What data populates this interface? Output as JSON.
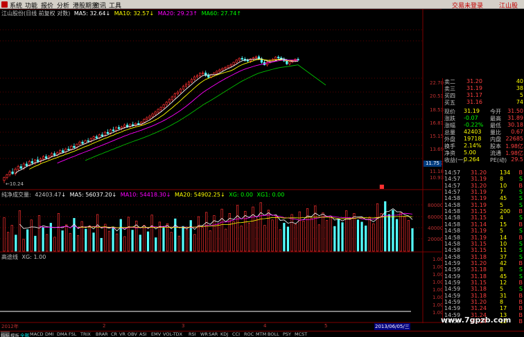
{
  "menu": {
    "items": [
      "系统",
      "功能",
      "报价",
      "分析",
      "港股期货",
      "资讯",
      "工具"
    ],
    "login": "交易未登录",
    "right": "江山股"
  },
  "main_caption": {
    "name": "江山股份(日线 前复权 对数)",
    "ma5": "MA5: 32.64",
    "ma10": "MA10: 32.57",
    "ma20": "MA20: 29.23",
    "ma60": "MA60: 27.74"
  },
  "vol_caption": {
    "name": "纯净成交量:",
    "val": "42403.47",
    "ma5": "MA5: 56037.20",
    "ma10": "MA10: 54418.30",
    "ma20": "MA20: 54902.25",
    "xg0": "XG: 0.00",
    "xg1": "XG1: 0.00"
  },
  "third_caption": {
    "name": "高途线",
    "xg": "XG: 1.00"
  },
  "y_main": [
    "22.70",
    "20.51",
    "18.53",
    "16.81",
    "15.15",
    "13.69",
    "12.37",
    "11.18",
    "10.93"
  ],
  "y_vol": [
    "80000",
    "60000",
    "40000",
    "20000"
  ],
  "y_third": [
    "1.00",
    "1.00",
    "1.00",
    "1.00",
    "1.00",
    "1.00",
    "1.00",
    "1.00"
  ],
  "low_label": "10.24",
  "hilite": "11.75",
  "x_axis": [
    "2012年",
    "2",
    "3",
    "4",
    "5",
    "2013/06/05/三"
  ],
  "quote": [
    {
      "l": "卖二",
      "v": "31.20",
      "n": "40"
    },
    {
      "l": "卖三",
      "v": "31.19",
      "n": "38"
    },
    {
      "l": "买四",
      "v": "31.17",
      "n": "5"
    },
    {
      "l": "买五",
      "v": "31.16",
      "n": "74"
    }
  ],
  "stats": [
    {
      "a": "现价",
      "b": "31.19",
      "c": "今开",
      "d": "31.50"
    },
    {
      "a": "涨跌",
      "b": "-0.07",
      "c": "最高",
      "d": "31.89"
    },
    {
      "a": "涨幅",
      "b": "-0.22%",
      "c": "最低",
      "d": "30.18"
    },
    {
      "a": "总量",
      "b": "42403",
      "c": "量比",
      "d": "0.67"
    },
    {
      "a": "外盘",
      "b": "19718",
      "c": "内盘",
      "d": "22685"
    },
    {
      "a": "换手",
      "b": "2.14%",
      "c": "股本",
      "d": "1.98亿"
    },
    {
      "a": "净资",
      "b": "5.00",
      "c": "流通",
      "d": "1.98亿"
    },
    {
      "a": "收益(一)",
      "b": "0.264",
      "c": "PE(动)",
      "d": "29.5"
    }
  ],
  "ticks": [
    {
      "t": "14:57",
      "p": "31.20",
      "v": "134",
      "s": "B"
    },
    {
      "t": "14:57",
      "p": "31.19",
      "v": "8",
      "s": "S"
    },
    {
      "t": "14:57",
      "p": "31.20",
      "v": "10",
      "s": "B"
    },
    {
      "t": "14:57",
      "p": "31.19",
      "v": "7",
      "s": "S"
    },
    {
      "t": "14:58",
      "p": "31.19",
      "v": "45",
      "s": "S"
    },
    {
      "t": "14:58",
      "p": "31.19",
      "v": "5",
      "s": "S"
    },
    {
      "t": "14:58",
      "p": "31.15",
      "v": "200",
      "s": "B"
    },
    {
      "t": "14:58",
      "p": "31.15",
      "v": "4",
      "s": "S"
    },
    {
      "t": "14:58",
      "p": "31.14",
      "v": "15",
      "s": "B"
    },
    {
      "t": "14:58",
      "p": "31.19",
      "v": "5",
      "s": "S"
    },
    {
      "t": "14:58",
      "p": "31.19",
      "v": "14",
      "s": "B"
    },
    {
      "t": "14:58",
      "p": "31.15",
      "v": "10",
      "s": "S"
    },
    {
      "t": "14:58",
      "p": "31.15",
      "v": "11",
      "s": "S"
    },
    {
      "t": "14:58",
      "p": "31.18",
      "v": "37",
      "s": "S"
    },
    {
      "t": "14:59",
      "p": "31.20",
      "v": "42",
      "s": "B"
    },
    {
      "t": "14:59",
      "p": "31.18",
      "v": "8",
      "s": "S"
    },
    {
      "t": "14:59",
      "p": "31.18",
      "v": "45",
      "s": "S"
    },
    {
      "t": "14:59",
      "p": "31.15",
      "v": "12",
      "s": "B"
    },
    {
      "t": "14:59",
      "p": "31.18",
      "v": "5",
      "s": "S"
    },
    {
      "t": "14:59",
      "p": "31.18",
      "v": "31",
      "s": "B"
    },
    {
      "t": "14:59",
      "p": "31.20",
      "v": "8",
      "s": "B"
    },
    {
      "t": "14:59",
      "p": "31.24",
      "v": "17",
      "s": "B"
    },
    {
      "t": "14:59",
      "p": "31.24",
      "v": "13",
      "s": "B"
    },
    {
      "t": "14:59",
      "p": "31.24",
      "v": "12",
      "s": "B"
    }
  ],
  "tabs": [
    "指标",
    "模板",
    "全部",
    "MACD",
    "DMI",
    "DMA",
    "FSL",
    "TRIX",
    "BRAR",
    "CR",
    "VR",
    "OBV",
    "ASI",
    "EMV",
    "VOL-TDX",
    "RSI",
    "WR",
    "SAR",
    "KDJ",
    "CCI",
    "ROC",
    "MTM",
    "BOLL",
    "PSY",
    "MCST"
  ],
  "watermark": "www.7gpzb.com",
  "candles": {
    "ohlc": [
      [
        10.5,
        10.9,
        10.24,
        10.8
      ],
      [
        10.8,
        11.2,
        10.6,
        11.1
      ],
      [
        11.1,
        11.6,
        10.9,
        11.4
      ],
      [
        11.4,
        11.8,
        11.1,
        11.2
      ],
      [
        11.2,
        11.9,
        11.0,
        11.7
      ],
      [
        11.7,
        12.2,
        11.5,
        12.0
      ],
      [
        12.0,
        12.3,
        11.7,
        11.8
      ],
      [
        11.8,
        12.5,
        11.6,
        12.3
      ],
      [
        12.3,
        12.6,
        12.0,
        12.1
      ],
      [
        12.1,
        12.8,
        12.0,
        12.6
      ],
      [
        12.6,
        13.0,
        12.3,
        12.4
      ],
      [
        12.4,
        12.9,
        12.2,
        12.8
      ],
      [
        12.8,
        13.2,
        12.5,
        12.6
      ],
      [
        12.6,
        13.1,
        12.4,
        12.9
      ],
      [
        12.9,
        13.4,
        12.7,
        13.2
      ],
      [
        13.2,
        13.5,
        12.9,
        13.0
      ],
      [
        13.0,
        13.4,
        12.8,
        13.3
      ],
      [
        13.3,
        13.8,
        13.1,
        13.6
      ],
      [
        13.6,
        13.9,
        13.2,
        13.4
      ],
      [
        13.4,
        13.9,
        13.2,
        13.7
      ],
      [
        13.7,
        14.2,
        13.5,
        14.0
      ],
      [
        14.0,
        14.3,
        13.6,
        13.8
      ],
      [
        13.8,
        14.4,
        13.6,
        14.2
      ],
      [
        14.2,
        14.6,
        13.9,
        14.1
      ],
      [
        14.1,
        14.8,
        14.0,
        14.6
      ],
      [
        14.6,
        15.0,
        14.3,
        14.4
      ],
      [
        14.4,
        15.0,
        14.2,
        14.9
      ],
      [
        14.9,
        15.4,
        14.7,
        15.2
      ],
      [
        15.2,
        15.5,
        14.8,
        15.0
      ],
      [
        15.0,
        15.6,
        14.9,
        15.4
      ],
      [
        15.4,
        15.8,
        15.1,
        15.3
      ],
      [
        15.3,
        15.9,
        15.1,
        15.7
      ],
      [
        15.7,
        16.2,
        15.5,
        16.0
      ],
      [
        16.0,
        16.3,
        15.6,
        15.8
      ],
      [
        15.8,
        16.5,
        15.6,
        16.3
      ],
      [
        16.3,
        16.7,
        16.0,
        16.1
      ],
      [
        16.1,
        16.9,
        16.0,
        16.7
      ],
      [
        16.7,
        17.2,
        16.4,
        16.5
      ],
      [
        16.5,
        17.3,
        16.3,
        17.1
      ],
      [
        17.1,
        17.6,
        16.8,
        16.9
      ],
      [
        16.9,
        17.7,
        16.7,
        17.5
      ],
      [
        17.5,
        17.9,
        17.1,
        17.3
      ],
      [
        17.3,
        17.8,
        17.0,
        17.6
      ],
      [
        17.6,
        18.2,
        17.3,
        17.9
      ],
      [
        17.9,
        18.3,
        17.4,
        17.6
      ],
      [
        17.6,
        18.2,
        17.4,
        18.0
      ],
      [
        18.0,
        18.5,
        17.6,
        17.8
      ],
      [
        17.8,
        18.4,
        17.6,
        18.2
      ],
      [
        18.2,
        18.7,
        17.9,
        18.0
      ],
      [
        18.0,
        18.6,
        17.8,
        18.4
      ],
      [
        18.4,
        19.1,
        18.2,
        18.9
      ],
      [
        18.9,
        19.5,
        18.6,
        19.2
      ],
      [
        19.2,
        19.8,
        18.9,
        19.5
      ],
      [
        19.5,
        20.2,
        19.2,
        19.9
      ],
      [
        19.9,
        20.6,
        19.6,
        20.3
      ],
      [
        20.3,
        21.1,
        20.0,
        20.8
      ],
      [
        20.8,
        21.5,
        20.4,
        21.2
      ],
      [
        21.2,
        22.0,
        20.9,
        21.8
      ],
      [
        21.8,
        22.6,
        21.4,
        22.3
      ],
      [
        22.3,
        23.2,
        21.9,
        22.9
      ],
      [
        22.9,
        23.8,
        22.5,
        23.5
      ],
      [
        23.5,
        24.5,
        23.1,
        24.2
      ],
      [
        24.2,
        25.0,
        23.8,
        24.6
      ],
      [
        24.6,
        25.6,
        24.3,
        25.3
      ],
      [
        25.3,
        26.4,
        25.0,
        26.0
      ],
      [
        26.0,
        27.0,
        25.6,
        26.5
      ],
      [
        26.5,
        27.5,
        26.0,
        27.1
      ],
      [
        27.1,
        28.2,
        26.8,
        27.8
      ],
      [
        27.8,
        28.9,
        27.4,
        28.5
      ],
      [
        28.5,
        29.3,
        28.0,
        28.8
      ],
      [
        28.8,
        29.8,
        28.3,
        29.5
      ],
      [
        29.5,
        30.2,
        28.9,
        29.6
      ],
      [
        29.6,
        30.3,
        28.5,
        28.9
      ],
      [
        28.9,
        29.6,
        28.0,
        28.4
      ],
      [
        28.4,
        29.4,
        28.1,
        29.1
      ],
      [
        29.1,
        29.9,
        28.8,
        29.6
      ],
      [
        29.6,
        30.4,
        29.1,
        30.1
      ],
      [
        30.1,
        30.9,
        29.7,
        30.5
      ],
      [
        30.5,
        31.2,
        30.0,
        30.9
      ],
      [
        30.9,
        31.6,
        30.4,
        31.2
      ],
      [
        31.2,
        32.0,
        30.8,
        31.7
      ],
      [
        31.7,
        32.5,
        31.2,
        32.0
      ],
      [
        32.0,
        33.0,
        31.6,
        32.8
      ],
      [
        32.8,
        33.8,
        32.4,
        33.5
      ],
      [
        33.5,
        34.4,
        33.0,
        34.1
      ],
      [
        34.1,
        34.8,
        33.4,
        33.8
      ],
      [
        33.8,
        34.5,
        33.0,
        33.4
      ],
      [
        33.4,
        34.0,
        32.8,
        33.2
      ],
      [
        33.2,
        34.1,
        32.6,
        33.9
      ],
      [
        33.9,
        34.6,
        33.3,
        34.3
      ],
      [
        34.3,
        35.0,
        33.8,
        34.6
      ],
      [
        34.6,
        35.2,
        33.5,
        33.9
      ],
      [
        33.9,
        34.5,
        32.4,
        32.8
      ],
      [
        32.8,
        33.6,
        31.8,
        32.0
      ],
      [
        32.0,
        33.2,
        31.5,
        32.9
      ],
      [
        32.9,
        33.8,
        32.4,
        33.4
      ],
      [
        33.4,
        34.2,
        32.8,
        33.8
      ],
      [
        33.8,
        34.8,
        33.4,
        34.5
      ],
      [
        34.5,
        35.1,
        33.8,
        34.2
      ],
      [
        34.2,
        34.8,
        33.4,
        33.7
      ],
      [
        33.7,
        34.4,
        32.9,
        33.2
      ],
      [
        33.2,
        33.9,
        31.9,
        32.3
      ],
      [
        32.3,
        33.2,
        31.8,
        32.9
      ],
      [
        32.9,
        33.6,
        32.5,
        33.3
      ],
      [
        33.3,
        34.1,
        32.8,
        33.8
      ],
      [
        33.8,
        34.4,
        33.1,
        33.5
      ]
    ],
    "vol": [
      62,
      35,
      48,
      30,
      75,
      22,
      40,
      58,
      28,
      66,
      44,
      31,
      52,
      26,
      70,
      38,
      49,
      33,
      61,
      29,
      55,
      41,
      47,
      34,
      68,
      24,
      50,
      37,
      45,
      32,
      59,
      27,
      63,
      39,
      56,
      30,
      48,
      36,
      67,
      25,
      54,
      43,
      51,
      35,
      60,
      28,
      46,
      40,
      57,
      31,
      64,
      44,
      72,
      38,
      66,
      50,
      78,
      41,
      70,
      55,
      85,
      47,
      74,
      52,
      82,
      60,
      90,
      48,
      76,
      58,
      64,
      40,
      52,
      45,
      68,
      50,
      73,
      56,
      79,
      61,
      84,
      49,
      71,
      57,
      65,
      46,
      60,
      53,
      75,
      62,
      70,
      58,
      54,
      47,
      63,
      51,
      88,
      70,
      92,
      68,
      76,
      59,
      71,
      64,
      57,
      42
    ],
    "ylim": [
      10,
      38
    ],
    "ymin_log": 10.24
  }
}
